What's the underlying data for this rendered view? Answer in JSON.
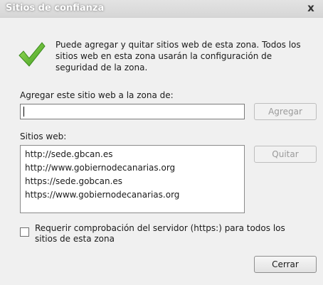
{
  "window": {
    "title": "Sitios de confianza",
    "close_label": "x"
  },
  "info": {
    "text": "Puede agregar y quitar sitios web de esta zona. Todos los sitios web en esta zona usarán la configuración de seguridad de la zona."
  },
  "add": {
    "label": "Agregar este sitio web a la zona de:",
    "value": "",
    "button": "Agregar"
  },
  "sites": {
    "label": "Sitios web:",
    "items": [
      "http://sede.gbcan.es",
      "http://www.gobiernodecanarias.org",
      "https://sede.gobcan.es",
      "https://www.gobiernodecanarias.org"
    ],
    "remove_button": "Quitar"
  },
  "https_check": {
    "checked": false,
    "label": "Requerir comprobación del servidor (https:) para todos los sitios de esta zona"
  },
  "footer": {
    "close_button": "Cerrar"
  },
  "colors": {
    "check_green": "#5cb82c",
    "dialog_bg": "#f0f0f0"
  }
}
